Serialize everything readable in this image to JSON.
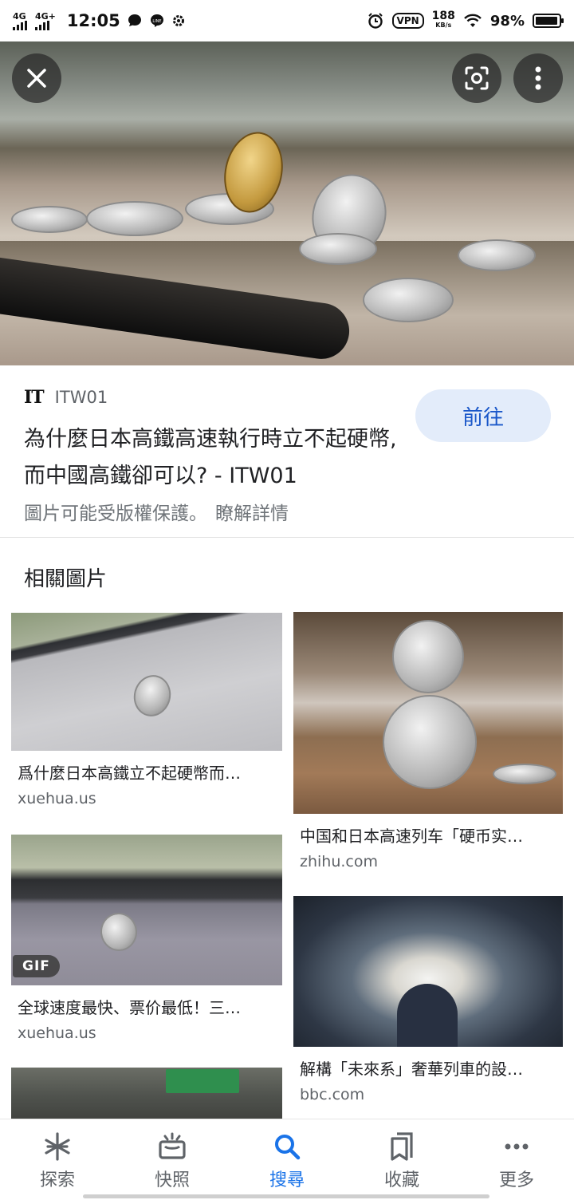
{
  "status_bar": {
    "network1": "4G",
    "network2": "4G+",
    "time": "12:05",
    "vpn": "VPN",
    "speed": "188",
    "speed_unit": "KB/s",
    "battery": "98%"
  },
  "hero": {
    "close_icon": "close-icon",
    "lens_icon": "lens-icon",
    "more_icon": "more-vert-icon"
  },
  "result": {
    "source_logo": "IT",
    "source_name": "ITW01",
    "title": "為什麼日本高鐵高速執行時立不起硬幣, 而中國高鐵卻可以? - ITW01",
    "visit_label": "前往",
    "copyright": "圖片可能受版權保護。",
    "learn_more": "瞭解詳情"
  },
  "related": {
    "title": "相關圖片",
    "items": [
      {
        "caption": "爲什麼日本高鐵立不起硬幣而…",
        "domain": "xuehua.us"
      },
      {
        "caption": "中国和日本高速列车「硬币实…",
        "domain": "zhihu.com"
      },
      {
        "caption": "全球速度最快、票价最低！三…",
        "domain": "xuehua.us",
        "badge": "GIF"
      },
      {
        "caption": "解構「未來系」奢華列車的設…",
        "domain": "bbc.com"
      }
    ]
  },
  "bottom_nav": [
    {
      "label": "探索",
      "icon": "asterisk-icon"
    },
    {
      "label": "快照",
      "icon": "snapshot-icon"
    },
    {
      "label": "搜尋",
      "icon": "search-icon",
      "active": true
    },
    {
      "label": "收藏",
      "icon": "collections-icon"
    },
    {
      "label": "更多",
      "icon": "more-horiz-icon"
    }
  ]
}
